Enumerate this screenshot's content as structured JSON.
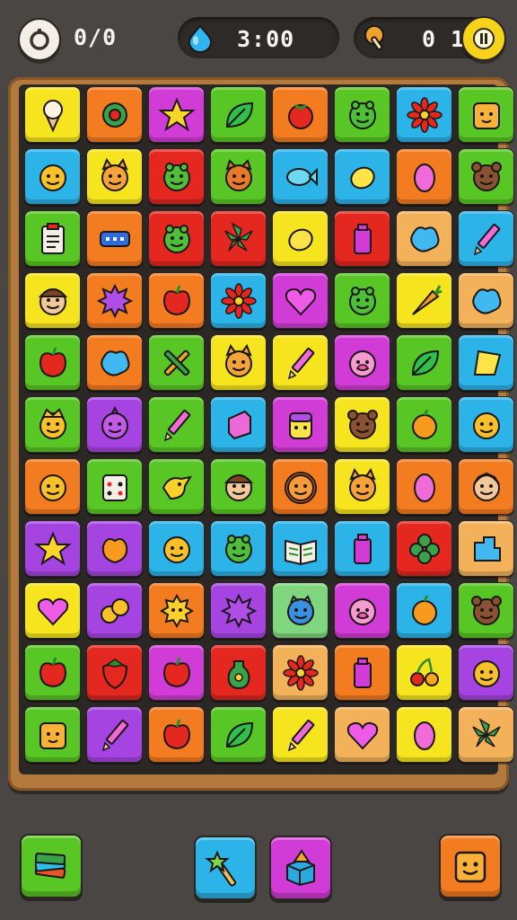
{
  "hud": {
    "moves": "0/0",
    "timer": "3:00",
    "coins": "0 1"
  },
  "palette": {
    "yellow": "#f6e51e",
    "orange": "#f47c20",
    "magenta": "#d23cd6",
    "green": "#58c624",
    "red": "#e4271f",
    "blue": "#2cb3e8",
    "purple": "#a544e0",
    "peach": "#f3b25a",
    "mint": "#7fd67f"
  },
  "board": {
    "rows": 11,
    "cols": 8,
    "tiles": [
      [
        [
          "yellow",
          "ice-cream"
        ],
        [
          "orange",
          "leaf-wreath"
        ],
        [
          "magenta",
          "star"
        ],
        [
          "green",
          "leaf"
        ],
        [
          "orange",
          "tomato"
        ],
        [
          "green",
          "frog"
        ],
        [
          "blue",
          "flower"
        ],
        [
          "green",
          "cube-face"
        ]
      ],
      [
        [
          "blue",
          "smiley"
        ],
        [
          "yellow",
          "cat"
        ],
        [
          "red",
          "frog"
        ],
        [
          "green",
          "fox"
        ],
        [
          "blue",
          "fish"
        ],
        [
          "blue",
          "lemon"
        ],
        [
          "orange",
          "egg"
        ],
        [
          "green",
          "bear"
        ]
      ],
      [
        [
          "green",
          "clipboard"
        ],
        [
          "orange",
          "battery"
        ],
        [
          "red",
          "frog"
        ],
        [
          "red",
          "palm"
        ],
        [
          "yellow",
          "lemon"
        ],
        [
          "red",
          "bottle"
        ],
        [
          "peach",
          "blob"
        ],
        [
          "blue",
          "pencil"
        ]
      ],
      [
        [
          "yellow",
          "boy"
        ],
        [
          "orange",
          "splat"
        ],
        [
          "orange",
          "apple"
        ],
        [
          "blue",
          "flower"
        ],
        [
          "magenta",
          "heart"
        ],
        [
          "green",
          "frog"
        ],
        [
          "yellow",
          "carrot"
        ],
        [
          "peach",
          "blob"
        ]
      ],
      [
        [
          "green",
          "apple"
        ],
        [
          "orange",
          "blob"
        ],
        [
          "green",
          "tools"
        ],
        [
          "yellow",
          "cat"
        ],
        [
          "yellow",
          "pencil"
        ],
        [
          "magenta",
          "pig"
        ],
        [
          "green",
          "leaf"
        ],
        [
          "blue",
          "flag"
        ]
      ],
      [
        [
          "green",
          "crown-smiley"
        ],
        [
          "purple",
          "onion"
        ],
        [
          "green",
          "pencil"
        ],
        [
          "blue",
          "block"
        ],
        [
          "magenta",
          "robot"
        ],
        [
          "yellow",
          "bear"
        ],
        [
          "green",
          "orange"
        ],
        [
          "blue",
          "smiley"
        ]
      ],
      [
        [
          "orange",
          "smiley"
        ],
        [
          "green",
          "dice"
        ],
        [
          "green",
          "bird"
        ],
        [
          "green",
          "boy"
        ],
        [
          "orange",
          "lion"
        ],
        [
          "yellow",
          "cat"
        ],
        [
          "orange",
          "egg"
        ],
        [
          "orange",
          "girl"
        ]
      ],
      [
        [
          "purple",
          "star"
        ],
        [
          "purple",
          "peach"
        ],
        [
          "blue",
          "smiley"
        ],
        [
          "blue",
          "frog"
        ],
        [
          "blue",
          "book"
        ],
        [
          "blue",
          "bottle"
        ],
        [
          "red",
          "clover"
        ],
        [
          "peach",
          "puzzle"
        ]
      ],
      [
        [
          "yellow",
          "heart"
        ],
        [
          "purple",
          "nuts"
        ],
        [
          "orange",
          "sun"
        ],
        [
          "purple",
          "splat"
        ],
        [
          "mint",
          "owl"
        ],
        [
          "magenta",
          "pig"
        ],
        [
          "blue",
          "orange"
        ],
        [
          "green",
          "bear"
        ]
      ],
      [
        [
          "green",
          "apple"
        ],
        [
          "red",
          "strawberry"
        ],
        [
          "magenta",
          "apple"
        ],
        [
          "red",
          "vase"
        ],
        [
          "peach",
          "flower"
        ],
        [
          "orange",
          "bottle"
        ],
        [
          "yellow",
          "cherry"
        ],
        [
          "purple",
          "smiley"
        ]
      ],
      [
        [
          "green",
          "cube-face"
        ],
        [
          "purple",
          "pencil"
        ],
        [
          "orange",
          "apple"
        ],
        [
          "green",
          "leaf"
        ],
        [
          "yellow",
          "pencil"
        ],
        [
          "peach",
          "heart"
        ],
        [
          "yellow",
          "egg"
        ],
        [
          "peach",
          "palm"
        ]
      ]
    ]
  },
  "toolbar": {
    "shuffle": {
      "color": "green",
      "icon": "cards-stack-icon"
    },
    "wand": {
      "color": "blue",
      "icon": "magic-wand-icon"
    },
    "hint": {
      "color": "magenta",
      "icon": "cube-icon"
    },
    "helper": {
      "color": "orange",
      "icon": "cube-face-icon"
    }
  }
}
